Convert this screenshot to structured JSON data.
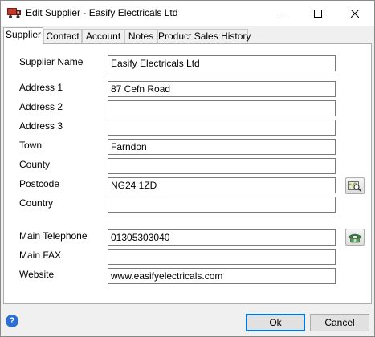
{
  "window": {
    "title": "Edit Supplier - Easify Electricals Ltd",
    "app_icon": "truck-icon",
    "controls": [
      "minimize-icon",
      "maximize-icon",
      "close-icon"
    ]
  },
  "tabs": [
    {
      "label": "Supplier",
      "active": true
    },
    {
      "label": "Contact",
      "active": false
    },
    {
      "label": "Account",
      "active": false
    },
    {
      "label": "Notes",
      "active": false
    },
    {
      "label": "Product Sales History",
      "active": false
    }
  ],
  "form": {
    "supplier_name": {
      "label": "Supplier Name",
      "value": "Easify Electricals Ltd"
    },
    "address1": {
      "label": "Address 1",
      "value": "87 Cefn Road"
    },
    "address2": {
      "label": "Address 2",
      "value": ""
    },
    "address3": {
      "label": "Address 3",
      "value": ""
    },
    "town": {
      "label": "Town",
      "value": "Farndon"
    },
    "county": {
      "label": "County",
      "value": ""
    },
    "postcode": {
      "label": "Postcode",
      "value": "NG24 1ZD"
    },
    "country": {
      "label": "Country",
      "value": ""
    },
    "main_telephone": {
      "label": "Main Telephone",
      "value": "01305303040"
    },
    "main_fax": {
      "label": "Main FAX",
      "value": ""
    },
    "website": {
      "label": "Website",
      "value": "www.easifyelectricals.com"
    }
  },
  "icons": {
    "postcode_lookup": "map-search-icon",
    "dial": "telephone-icon",
    "help": "help-icon"
  },
  "help_glyph": "?",
  "buttons": {
    "ok": "Ok",
    "cancel": "Cancel"
  },
  "colors": {
    "accent": "#0078d7",
    "help": "#2a6fd1"
  }
}
